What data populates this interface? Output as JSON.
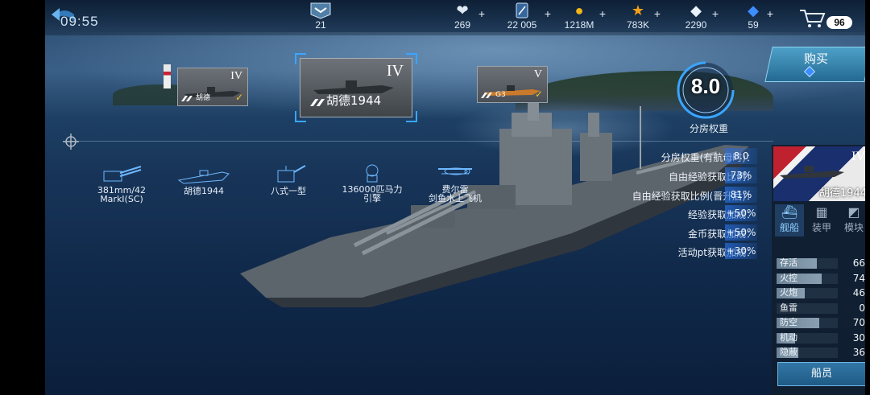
{
  "status": {
    "clock": "09:55"
  },
  "topbar": {
    "rank": {
      "icon": "rank-chevron-icon",
      "value": "21"
    },
    "resources": [
      {
        "name": "stamina",
        "icon": "heart-icon",
        "value": "269"
      },
      {
        "name": "cards",
        "icon": "card-icon",
        "value": "22 005"
      },
      {
        "name": "gold",
        "icon": "coin-icon",
        "value": "1218M"
      },
      {
        "name": "stars",
        "icon": "star-icon",
        "value": "783K"
      },
      {
        "name": "diamonds",
        "icon": "diamond-icon",
        "value": "2290"
      },
      {
        "name": "gems",
        "icon": "gem-icon",
        "value": "59"
      }
    ],
    "cart_badge": "96"
  },
  "ship_cards": {
    "left": {
      "tier": "IV",
      "name": "胡德"
    },
    "selected": {
      "tier": "IV",
      "name": "胡德1944"
    },
    "right": {
      "tier": "V",
      "name": "G3"
    }
  },
  "gauge": {
    "value": "8.0",
    "label": "分房权重"
  },
  "buy": {
    "label": "购买"
  },
  "equipment": [
    {
      "icon": "main-gun-icon",
      "line1": "381mm/42",
      "line2": "MarkI(SC)"
    },
    {
      "icon": "hull-icon",
      "line1": "胡德1944",
      "line2": ""
    },
    {
      "icon": "fire-control-icon",
      "line1": "八式一型",
      "line2": ""
    },
    {
      "icon": "engine-icon",
      "line1": "136000匹马力",
      "line2": "引擎"
    },
    {
      "icon": "seaplane-icon",
      "line1": "费尔雷",
      "line2": "剑鱼水上飞机"
    }
  ],
  "bonuses": [
    {
      "label": "分房权重(有航母时)：",
      "value": "8.0"
    },
    {
      "label": "自由经验获取比例：",
      "value": "73%"
    },
    {
      "label": "自由经验获取比例(晋升后)：",
      "value": "81%"
    },
    {
      "label": "经验获取加成：",
      "value": "+50%"
    },
    {
      "label": "金币获取加成：",
      "value": "+50%"
    },
    {
      "label": "活动pt获取加成：",
      "value": "+30%"
    }
  ],
  "panel": {
    "ship": {
      "tier": "IV",
      "name": "胡德1944"
    },
    "tabs": [
      {
        "label": "舰船",
        "icon": "ship-tab-icon",
        "active": true
      },
      {
        "label": "装甲",
        "icon": "armor-tab-icon",
        "active": false
      },
      {
        "label": "模块",
        "icon": "module-tab-icon",
        "active": false
      }
    ],
    "attributes": [
      {
        "label": "存活",
        "value": "66",
        "fraction": 0.66
      },
      {
        "label": "火控",
        "value": "74",
        "fraction": 0.74
      },
      {
        "label": "火炮",
        "value": "46",
        "fraction": 0.46
      },
      {
        "label": "鱼雷",
        "value": "0",
        "fraction": 0.0
      },
      {
        "label": "防空",
        "value": "70",
        "fraction": 0.7
      },
      {
        "label": "机动",
        "value": "30",
        "fraction": 0.3
      },
      {
        "label": "隐蔽",
        "value": "36",
        "fraction": 0.36
      }
    ],
    "crew_button": "船员"
  },
  "colors": {
    "accent": "#3aa6ff",
    "bonus_bar": "#2a6edc",
    "gold_check": "#f3c322"
  }
}
